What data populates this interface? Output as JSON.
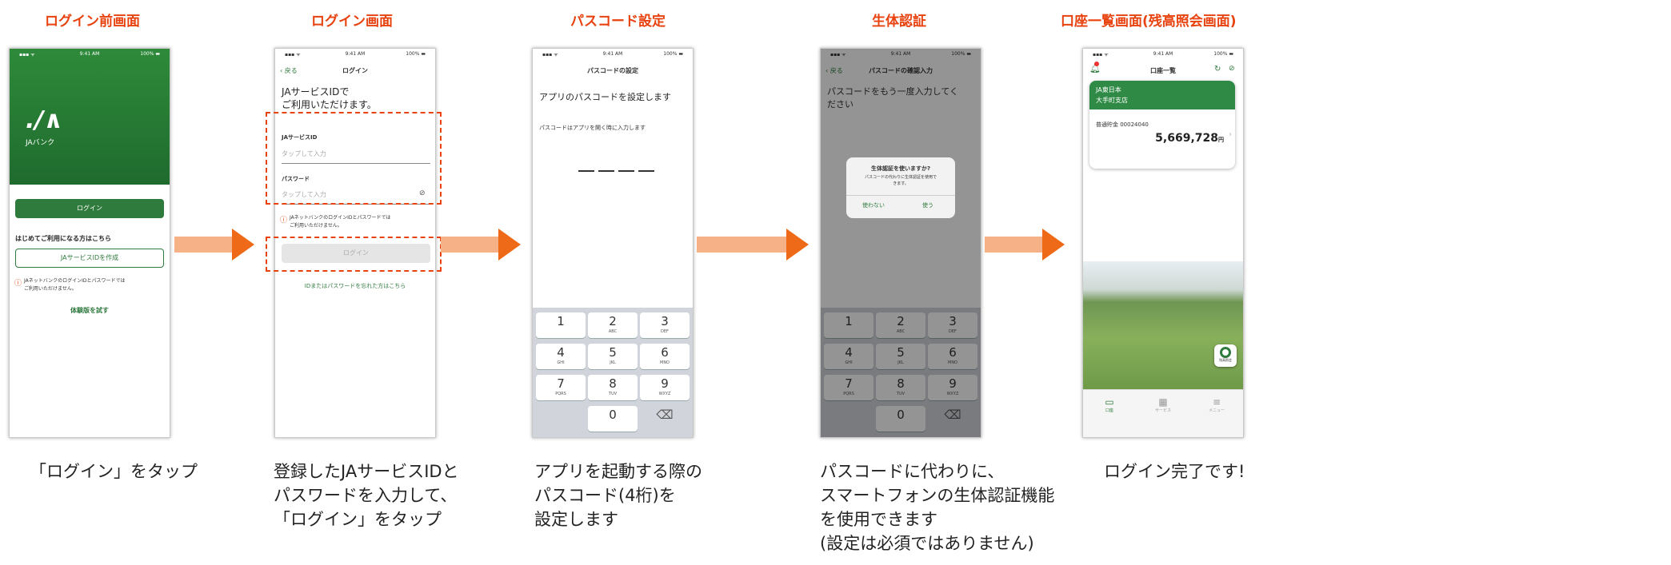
{
  "steps": [
    {
      "title": "ログイン前画面",
      "caption": "「ログイン」をタップ"
    },
    {
      "title": "ログイン画面",
      "caption": "登録したJAサービスIDと\nパスワードを入力して、\n「ログイン」をタップ"
    },
    {
      "title": "パスコード設定",
      "caption": "アプリを起動する際の\nパスコード(4桁)を\n設定します"
    },
    {
      "title": "生体認証",
      "caption": "パスコードに代わりに、\nスマートフォンの生体認証機能\nを使用できます\n(設定は必須ではありません)"
    },
    {
      "title": "口座一覧画面(残高照会画面)",
      "caption": "ログイン完了です!"
    }
  ],
  "status_bar": {
    "time": "9:41 AM",
    "signal": "▪▪▪ ᯤ",
    "battery": "100% ▬"
  },
  "screen1": {
    "logo": "JAバンク",
    "login_button": "ログイン",
    "first_time": "はじめてご利用になる方はこちら",
    "create_id_button": "JAサービスIDを作成",
    "warning": "JAネットバンクのログインIDとパスワードでは\nご利用いただけません。",
    "trial_link": "体験版を試す"
  },
  "screen2": {
    "back": "戻る",
    "nav_title": "ログイン",
    "heading": "JAサービスIDで\nご利用いただけます。",
    "id_label": "JAサービスID",
    "id_placeholder": "タップして入力",
    "pw_label": "パスワード",
    "pw_placeholder": "タップして入力",
    "warning": "JAネットバンクのログインIDとパスワードでは\nご利用いただけません。",
    "login_button": "ログイン",
    "forgot_link": "IDまたはパスワードを忘れた方はこちら"
  },
  "screen3": {
    "nav_title": "パスコードの設定",
    "heading": "アプリのパスコードを設定します",
    "note": "パスコードはアプリを開く時に入力します"
  },
  "keypad": [
    {
      "n": "1",
      "l": ""
    },
    {
      "n": "2",
      "l": "ABC"
    },
    {
      "n": "3",
      "l": "DEF"
    },
    {
      "n": "4",
      "l": "GHI"
    },
    {
      "n": "5",
      "l": "JKL"
    },
    {
      "n": "6",
      "l": "MNO"
    },
    {
      "n": "7",
      "l": "PQRS"
    },
    {
      "n": "8",
      "l": "TUV"
    },
    {
      "n": "9",
      "l": "WXYZ"
    },
    {
      "n": "",
      "l": ""
    },
    {
      "n": "0",
      "l": ""
    },
    {
      "n": "⌫",
      "l": ""
    }
  ],
  "screen4": {
    "back": "戻る",
    "nav_title": "パスコードの確認入力",
    "heading": "パスコードをもう一度入力してく\nださい",
    "dialog_title": "生体認証を使いますか?",
    "dialog_body": "パスコードの代わりに生体認証を使用で\nきます。",
    "dialog_no": "使わない",
    "dialog_yes": "使う"
  },
  "screen5": {
    "nav_title": "口座一覧",
    "bank_name": "JA東日本",
    "branch": "大手町支店",
    "account": "普通貯金 00024040",
    "balance": "5,669,728",
    "yen": "円",
    "tabs": [
      "口座",
      "サービス",
      "メニュー"
    ],
    "fab_label": "残高照会"
  }
}
